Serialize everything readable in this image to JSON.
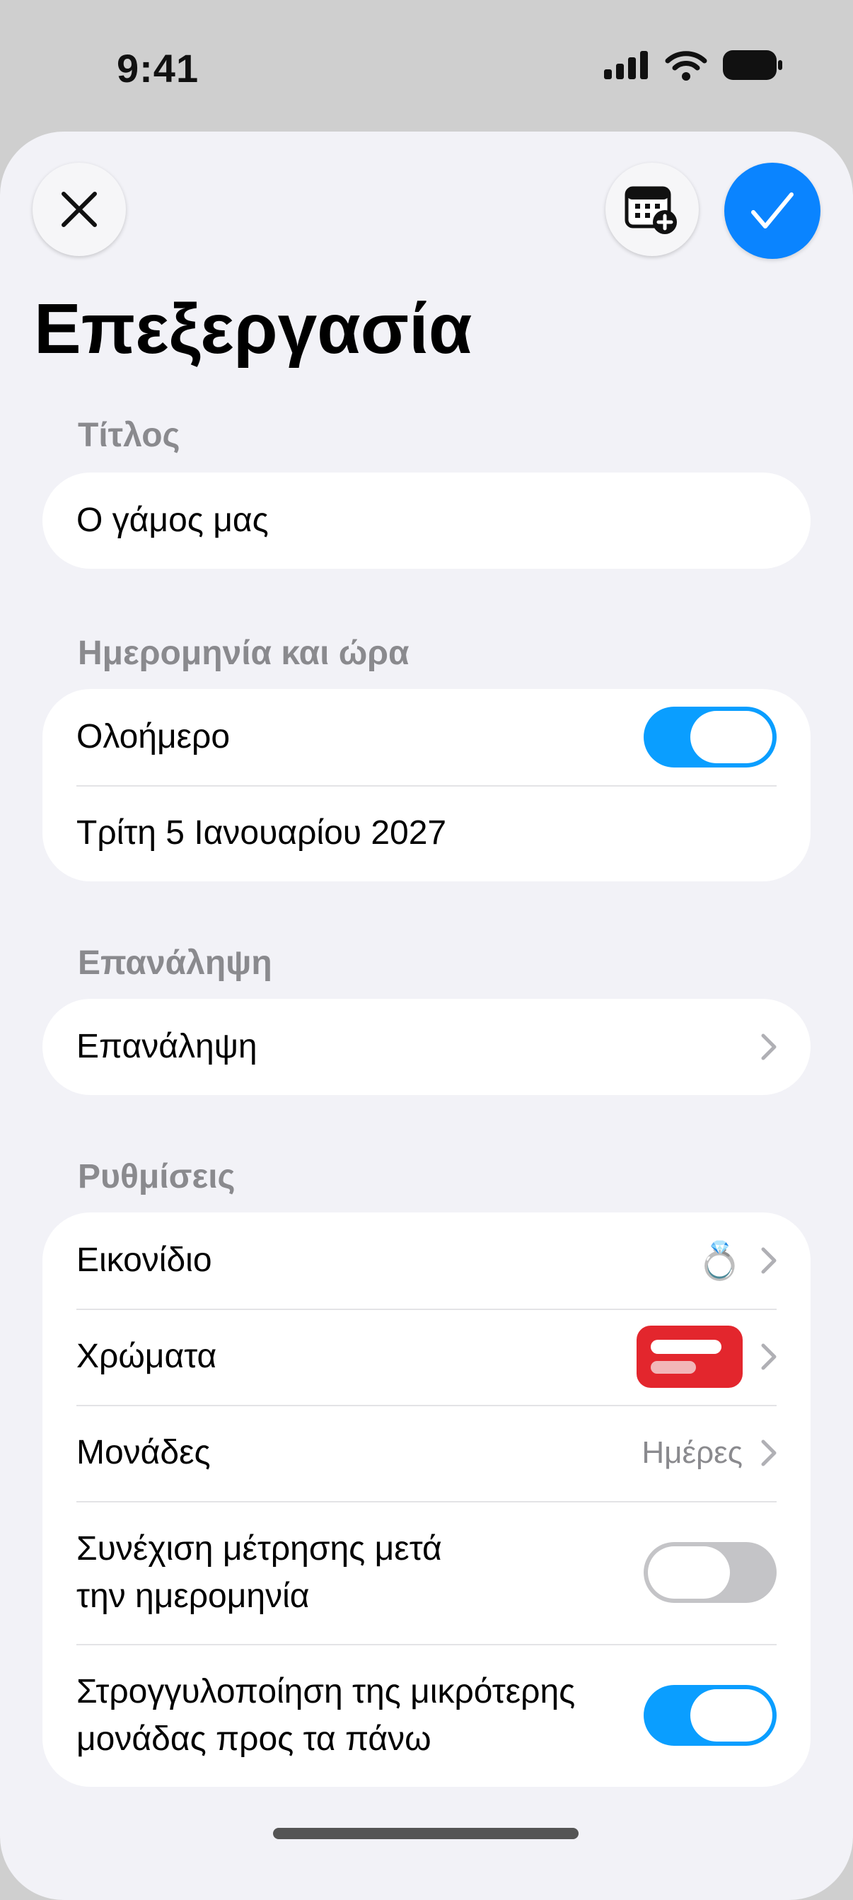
{
  "status_bar": {
    "time": "9:41",
    "icons": [
      "cellular-signal-icon",
      "wifi-icon",
      "battery-icon"
    ]
  },
  "header": {
    "title": "Επεξεργασία",
    "close_icon": "close-icon",
    "calendar_icon": "calendar-add-icon",
    "confirm_icon": "checkmark-icon"
  },
  "sections": {
    "title": {
      "header": "Τίτλος",
      "value": "Ο γάμος μας"
    },
    "datetime": {
      "header": "Ημερομηνία και ώρα",
      "all_day_label": "Ολοήμερο",
      "all_day_on": true,
      "date": "Τρίτη 5 Ιανουαρίου 2027"
    },
    "repeat": {
      "header": "Επανάληψη",
      "label": "Επανάληψη"
    },
    "settings": {
      "header": "Ρυθμίσεις",
      "icon_label": "Εικονίδιο",
      "icon_value": "💍",
      "colors_label": "Χρώματα",
      "color_value": "#e3262d",
      "units_label": "Μονάδες",
      "units_value": "Ημέρες",
      "continue_line1": "Συνέχιση μέτρησης μετά",
      "continue_line2": "την ημερομηνία",
      "continue_on": false,
      "round_line1": "Στρογγυλοποίηση της μικρότερης",
      "round_line2": "μονάδας προς τα πάνω",
      "round_on": true
    }
  },
  "accent_color": "#0a84ff"
}
